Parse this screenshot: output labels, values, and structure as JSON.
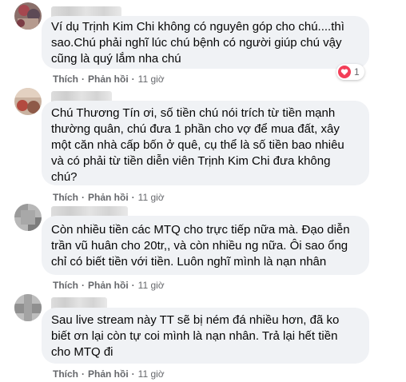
{
  "comments": [
    {
      "text": "Ví dụ Trịnh Kim Chi không có nguyên góp cho chú....thì\nsao.Chú phải nghĩ lúc chú bệnh có người giúp chú vậy\ncũng là quý lắm nha chú",
      "like_label": "Thích",
      "reply_label": "Phản hồi",
      "time": "11 giờ",
      "reaction_count": "1"
    },
    {
      "text": "Chú Thương Tín ơi, số tiền chú nói trích từ tiền mạnh\nthường quân, chú đưa 1 phần cho vợ để mua đất, xây\nmột căn nhà cấp bốn ở quê, cụ thể là số tiền bao nhiêu\nvà có phải từ tiền diễn viên Trịnh Kim Chi đưa không\nchú?",
      "like_label": "Thích",
      "reply_label": "Phản hồi",
      "time": "11 giờ"
    },
    {
      "text": "Còn nhiều tiền các MTQ cho trực tiếp nữa mà. Đạo diễn\ntrần vũ huân cho 20tr,, và còn nhiều ng nữa. Ôi sao ổng\nchỉ có biết tiền với tiền. Luôn nghĩ mình là nạn nhân",
      "like_label": "Thích",
      "reply_label": "Phản hồi",
      "time": "11 giờ"
    },
    {
      "text": "Sau live stream này TT sẽ bị ném đá nhiều hơn, đã ko\nbiết ơn lại còn tự coi mình là nạn nhân. Trả lại hết tiền\ncho MTQ đi",
      "like_label": "Thích",
      "reply_label": "Phản hồi",
      "time": "11 giờ"
    }
  ]
}
